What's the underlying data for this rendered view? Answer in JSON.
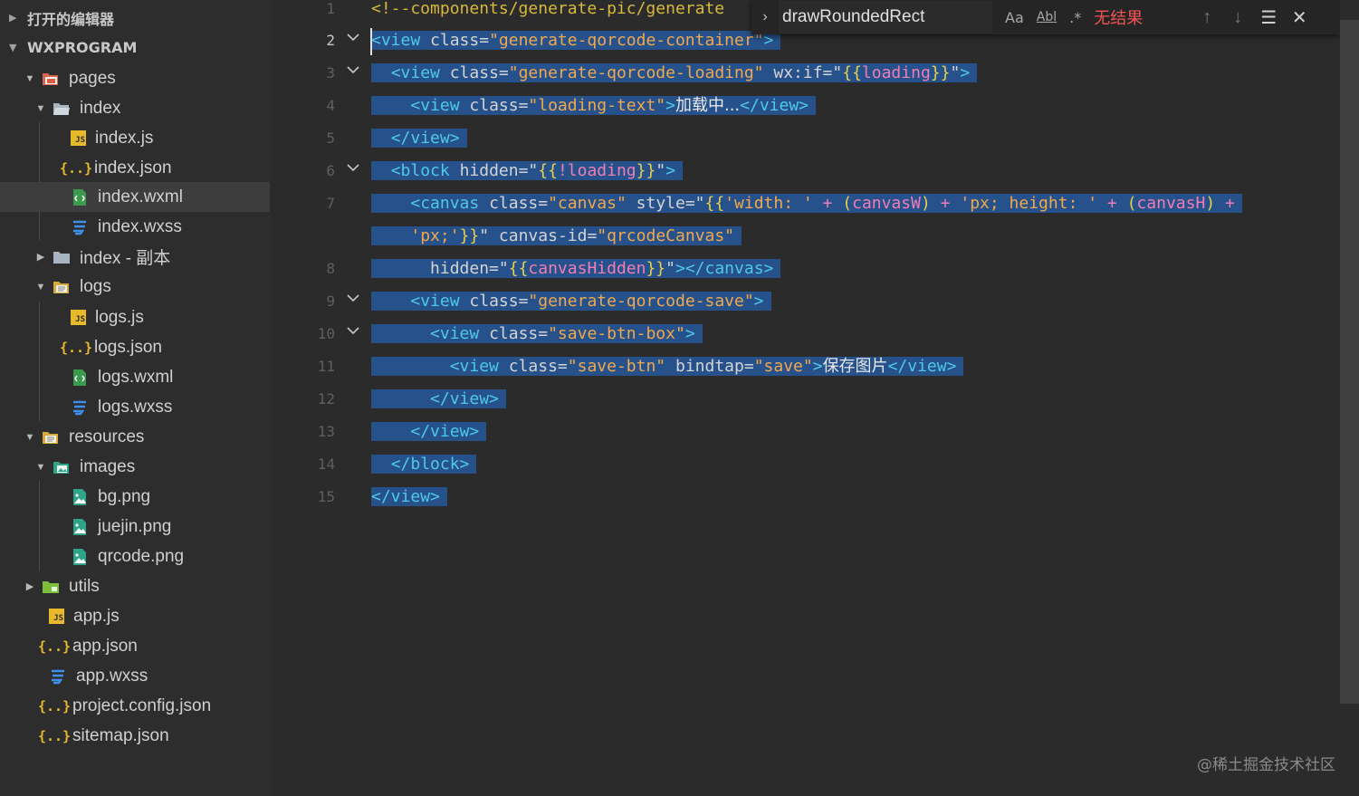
{
  "sidebar": {
    "open_editors_label": "打开的编辑器",
    "workspace_label": "WXPROGRAM",
    "items": [
      {
        "label": "pages",
        "icon": "folder-open-red-icon"
      },
      {
        "label": "index",
        "icon": "folder-open-icon"
      },
      {
        "label": "index.js",
        "icon": "js-file-icon"
      },
      {
        "label": "index.json",
        "icon": "json-file-icon"
      },
      {
        "label": "index.wxml",
        "icon": "wxml-file-icon"
      },
      {
        "label": "index.wxss",
        "icon": "css-file-icon"
      },
      {
        "label": "index - 副本",
        "icon": "folder-closed-icon"
      },
      {
        "label": "logs",
        "icon": "folder-open-yellow-icon"
      },
      {
        "label": "logs.js",
        "icon": "js-file-icon"
      },
      {
        "label": "logs.json",
        "icon": "json-file-icon"
      },
      {
        "label": "logs.wxml",
        "icon": "wxml-file-icon"
      },
      {
        "label": "logs.wxss",
        "icon": "css-file-icon"
      },
      {
        "label": "resources",
        "icon": "folder-open-yellow-icon"
      },
      {
        "label": "images",
        "icon": "folder-open-green-icon"
      },
      {
        "label": "bg.png",
        "icon": "image-file-icon"
      },
      {
        "label": "juejin.png",
        "icon": "image-file-icon"
      },
      {
        "label": "qrcode.png",
        "icon": "image-file-icon"
      },
      {
        "label": "utils",
        "icon": "folder-closed-green-icon"
      },
      {
        "label": "app.js",
        "icon": "js-file-icon"
      },
      {
        "label": "app.json",
        "icon": "json-file-icon"
      },
      {
        "label": "app.wxss",
        "icon": "css-file-icon"
      },
      {
        "label": "project.config.json",
        "icon": "json-file-icon"
      },
      {
        "label": "sitemap.json",
        "icon": "json-file-icon"
      }
    ],
    "js_badge": "JS",
    "json_badge": "{..}"
  },
  "editor": {
    "line_numbers": [
      "1",
      "2",
      "3",
      "4",
      "5",
      "6",
      "7",
      "8",
      "9",
      "10",
      "11",
      "12",
      "13",
      "14",
      "15"
    ],
    "lines": {
      "l1": {
        "c": "<!--components/generate-pic/generate"
      },
      "l2": {
        "t1": "<view",
        "a1": "class=",
        "s1": "\"generate-qorcode-container\"",
        "t2": ">"
      },
      "l3": {
        "t1": "<view",
        "a1": "class=",
        "s1": "\"generate-qorcode-loading\"",
        "a2": "wx:if=",
        "q1": "\"",
        "b1": "{{",
        "v1": "loading",
        "b2": "}}",
        "q2": "\"",
        "t2": ">"
      },
      "l4": {
        "t1": "<view",
        "a1": "class=",
        "s1": "\"loading-text\"",
        "t2": ">",
        "x1": "加载中...",
        "t3": "</view>"
      },
      "l5": {
        "t1": "</view>"
      },
      "l6": {
        "t1": "<block",
        "a1": "hidden=",
        "q1": "\"",
        "b1": "{{",
        "v1": "!loading",
        "b2": "}}",
        "q2": "\"",
        "t2": ">"
      },
      "l7a": {
        "t1": "<canvas",
        "a1": "class=",
        "s1": "\"canvas\"",
        "a2": "style=",
        "q1": "\"",
        "b1": "{{",
        "s2": "'width: '",
        "o1": "+",
        "o2": "(",
        "v1": "canvasW",
        "o3": ")",
        "o4": "+",
        "s3": "'px; height: '",
        "o5": "+",
        "o6": "(",
        "v2": "canvasH",
        "o7": ")",
        "o8": "+"
      },
      "l7b": {
        "s1": "'px;'",
        "b1": "}}",
        "q1": "\"",
        "a1": "canvas-id=",
        "s2": "\"qrcodeCanvas\""
      },
      "l8": {
        "a1": "hidden=",
        "q1": "\"",
        "b1": "{{",
        "v1": "canvasHidden",
        "b2": "}}",
        "q2": "\"",
        "t1": "></canvas>"
      },
      "l9": {
        "t1": "<view",
        "a1": "class=",
        "s1": "\"generate-qorcode-save\"",
        "t2": ">"
      },
      "l10": {
        "t1": "<view",
        "a1": "class=",
        "s1": "\"save-btn-box\"",
        "t2": ">"
      },
      "l11": {
        "t1": "<view",
        "a1": "class=",
        "s1": "\"save-btn\"",
        "a2": "bindtap=",
        "s2": "\"save\"",
        "t2": ">",
        "x1": "保存图片",
        "t3": "</view>"
      },
      "l12": {
        "t1": "</view>"
      },
      "l13": {
        "t1": "</view>"
      },
      "l14": {
        "t1": "</block>"
      },
      "l15": {
        "t1": "</view>"
      }
    }
  },
  "find": {
    "query": "drawRoundedRect",
    "match_case": "Aa",
    "whole_word": "Abl",
    "regex": ".*",
    "result": "无结果"
  },
  "watermark": "@稀土掘金技术社区"
}
